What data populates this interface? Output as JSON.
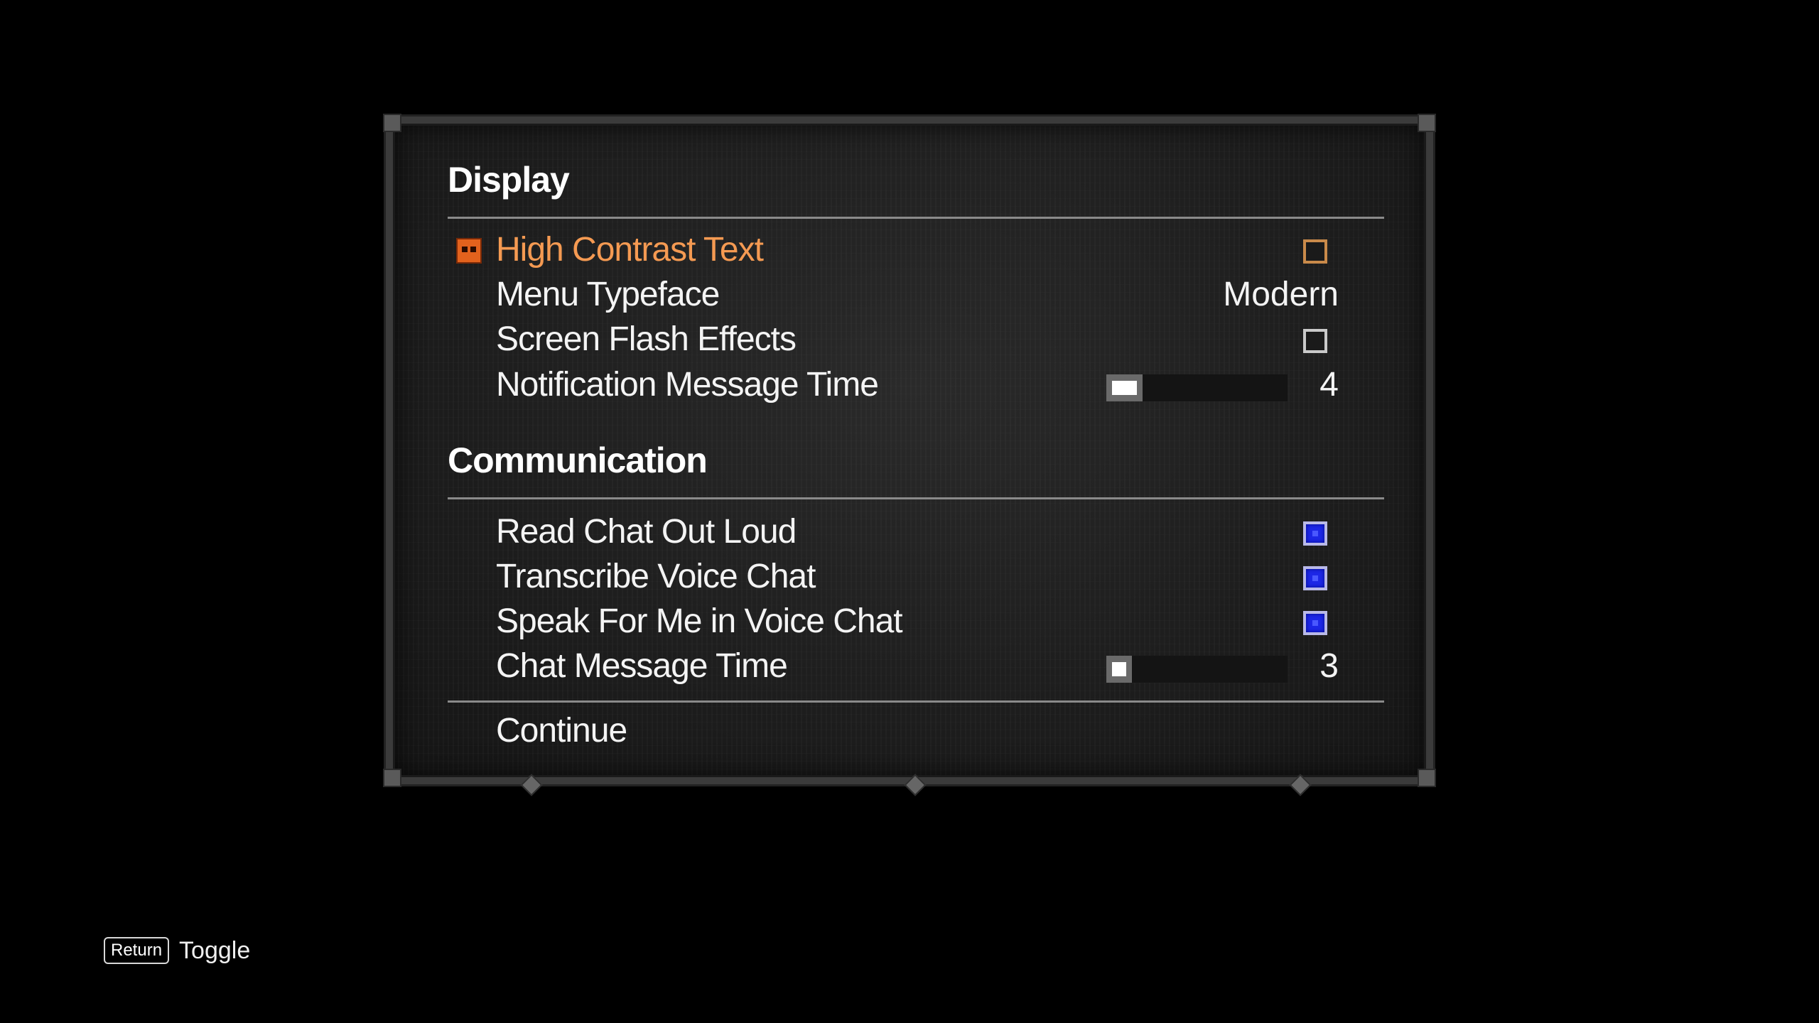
{
  "sections": [
    {
      "title": "Display",
      "rows": [
        {
          "label": "High Contrast Text",
          "control": "checkbox",
          "checked": false,
          "selected": true
        },
        {
          "label": "Menu Typeface",
          "control": "value",
          "value": "Modern"
        },
        {
          "label": "Screen Flash Effects",
          "control": "checkbox",
          "checked": false
        },
        {
          "label": "Notification Message Time",
          "control": "slider",
          "value": "4",
          "fill_fraction": 0.2
        }
      ]
    },
    {
      "title": "Communication",
      "rows": [
        {
          "label": "Read Chat Out Loud",
          "control": "checkbox",
          "checked": true
        },
        {
          "label": "Transcribe Voice Chat",
          "control": "checkbox",
          "checked": true
        },
        {
          "label": "Speak For Me in Voice Chat",
          "control": "checkbox",
          "checked": true
        },
        {
          "label": "Chat Message Time",
          "control": "slider",
          "value": "3",
          "fill_fraction": 0.14
        }
      ]
    }
  ],
  "continue_label": "Continue",
  "hint": {
    "key": "Return",
    "label": "Toggle"
  },
  "colors": {
    "selected": "#f59a52",
    "checked": "#1d27e6",
    "background": "#000000"
  }
}
